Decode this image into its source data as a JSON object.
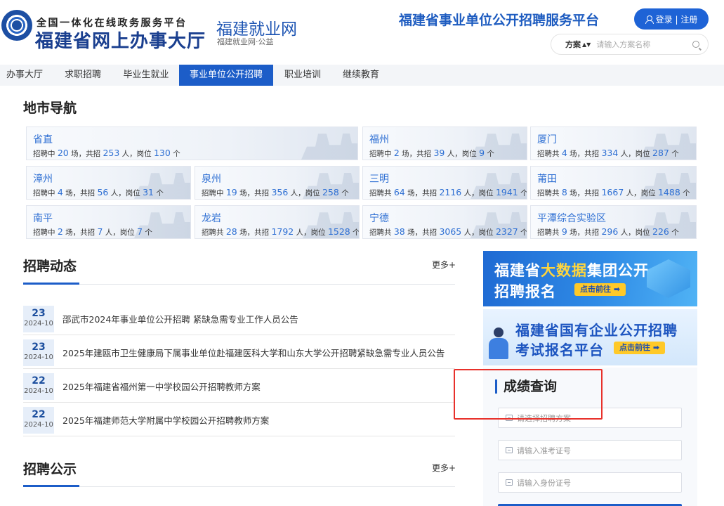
{
  "header": {
    "logo_sub": "全国一体化在线政务服务平台",
    "logo_main": "福建省网上办事大厅",
    "site_name": "福建就业网",
    "site_sub": "福建就业网·公益",
    "platform_title": "福建省事业单位公开招聘服务平台",
    "login_label": "登录 | 注册",
    "search_type": "方案",
    "search_placeholder": "请输入方案名称",
    "icons": [
      "emblem-logo",
      "user-icon",
      "sort-icon",
      "search-icon"
    ]
  },
  "nav": {
    "items": [
      {
        "label": "办事大厅"
      },
      {
        "label": "求职招聘"
      },
      {
        "label": "毕业生就业"
      },
      {
        "label": "事业单位公开招聘",
        "active": true
      },
      {
        "label": "职业培训"
      },
      {
        "label": "继续教育"
      }
    ]
  },
  "city_nav": {
    "title": "地市导航",
    "cities": [
      {
        "name": "省直",
        "status": "招聘中",
        "sessions": "20",
        "people": "253",
        "posts": "130"
      },
      {
        "name": "福州",
        "status": "招聘中",
        "sessions": "2",
        "people": "39",
        "posts": "9"
      },
      {
        "name": "厦门",
        "status": "招聘共",
        "sessions": "4",
        "people": "334",
        "posts": "287"
      },
      {
        "name": "漳州",
        "status": "招聘中",
        "sessions": "4",
        "people": "56",
        "posts": "31"
      },
      {
        "name": "泉州",
        "status": "招聘中",
        "sessions": "19",
        "people": "356",
        "posts": "258"
      },
      {
        "name": "三明",
        "status": "招聘共",
        "sessions": "64",
        "people": "2116",
        "posts": "1941"
      },
      {
        "name": "莆田",
        "status": "招聘共",
        "sessions": "8",
        "people": "1667",
        "posts": "1488"
      },
      {
        "name": "南平",
        "status": "招聘中",
        "sessions": "2",
        "people": "7",
        "posts": "7"
      },
      {
        "name": "龙岩",
        "status": "招聘共",
        "sessions": "28",
        "people": "1792",
        "posts": "1528"
      },
      {
        "name": "宁德",
        "status": "招聘共",
        "sessions": "38",
        "people": "3065",
        "posts": "2327"
      },
      {
        "name": "平潭综合实验区",
        "status": "招聘共",
        "sessions": "9",
        "people": "296",
        "posts": "226"
      }
    ],
    "unit_sessions": "场，共招",
    "unit_people": "人，岗位",
    "unit_posts": "个"
  },
  "news": {
    "title": "招聘动态",
    "more": "更多+",
    "items": [
      {
        "day": "23",
        "ym": "2024-10",
        "text": "邵武市2024年事业单位公开招聘 紧缺急需专业工作人员公告"
      },
      {
        "day": "23",
        "ym": "2024-10",
        "text": "2025年建瓯市卫生健康局下属事业单位赴福建医科大学和山东大学公开招聘紧缺急需专业人员公告"
      },
      {
        "day": "22",
        "ym": "2024-10",
        "text": "2025年福建省福州第一中学校园公开招聘教师方案"
      },
      {
        "day": "22",
        "ym": "2024-10",
        "text": "2025年福建师范大学附属中学校园公开招聘教师方案"
      }
    ]
  },
  "notice": {
    "title": "招聘公示",
    "more": "更多+"
  },
  "banners": {
    "b1_line1_pre": "福建省",
    "b1_line1_hl": "大数据",
    "b1_line1_post": "集团公开",
    "b1_line2": "招聘报名",
    "b1_go": "点击前往 ➡",
    "b2_line1": "福建省国有企业公开招聘",
    "b2_line2": "考试报名平台",
    "b2_go": "点击前往 ➡"
  },
  "score_query": {
    "title": "成绩查询",
    "plan_placeholder": "请选择招聘方案",
    "ticket_placeholder": "请输入准考证号",
    "id_placeholder": "请输入身份证号"
  },
  "colors": {
    "brand_blue": "#1c5dc8",
    "highlight_red": "#e8312b",
    "accent_yellow": "#ffc928"
  }
}
